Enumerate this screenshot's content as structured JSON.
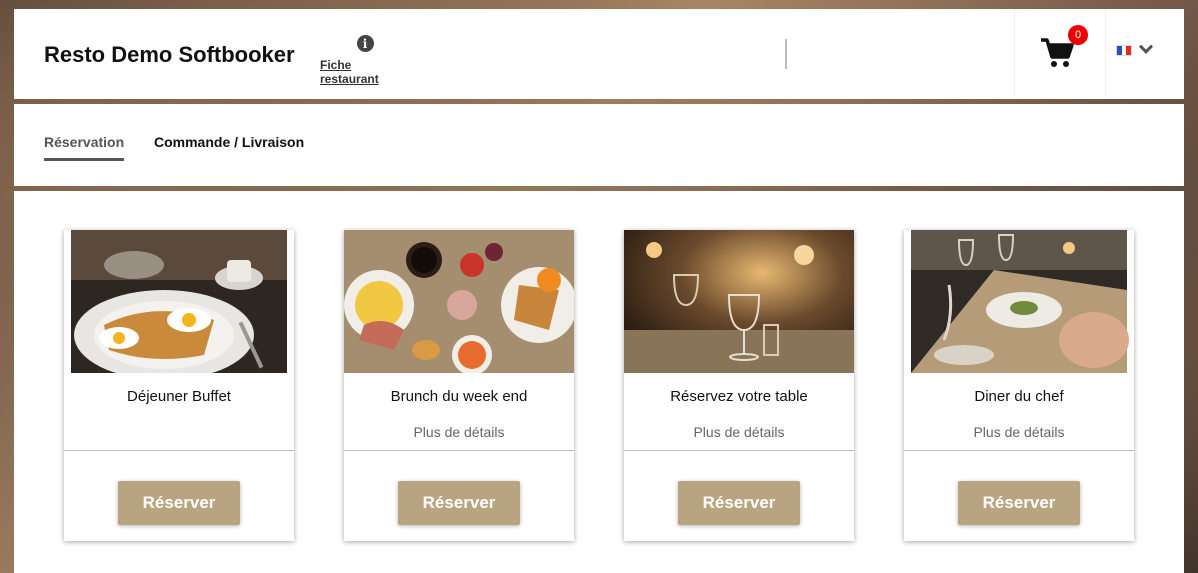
{
  "header": {
    "brand": "Resto Demo Softbooker",
    "info_label": "Fiche restaurant",
    "cart_count": "0",
    "language": "fr",
    "info_icon": "info-circle-icon",
    "cart_icon": "shopping-cart-icon",
    "chevron_icon": "chevron-down-icon"
  },
  "tabs": [
    {
      "label": "Réservation",
      "active": true
    },
    {
      "label": "Commande / Livraison",
      "active": false
    }
  ],
  "cards": [
    {
      "title": "Déjeuner Buffet",
      "more": "",
      "button": "Réserver"
    },
    {
      "title": "Brunch du week end",
      "more": "Plus de détails",
      "button": "Réserver"
    },
    {
      "title": "Réservez votre table",
      "more": "Plus de détails",
      "button": "Réserver"
    },
    {
      "title": "Diner du chef",
      "more": "Plus de détails",
      "button": "Réserver"
    }
  ],
  "colors": {
    "accent": "#b9a482",
    "badge": "#ee0000",
    "active_tab": "#555555"
  }
}
